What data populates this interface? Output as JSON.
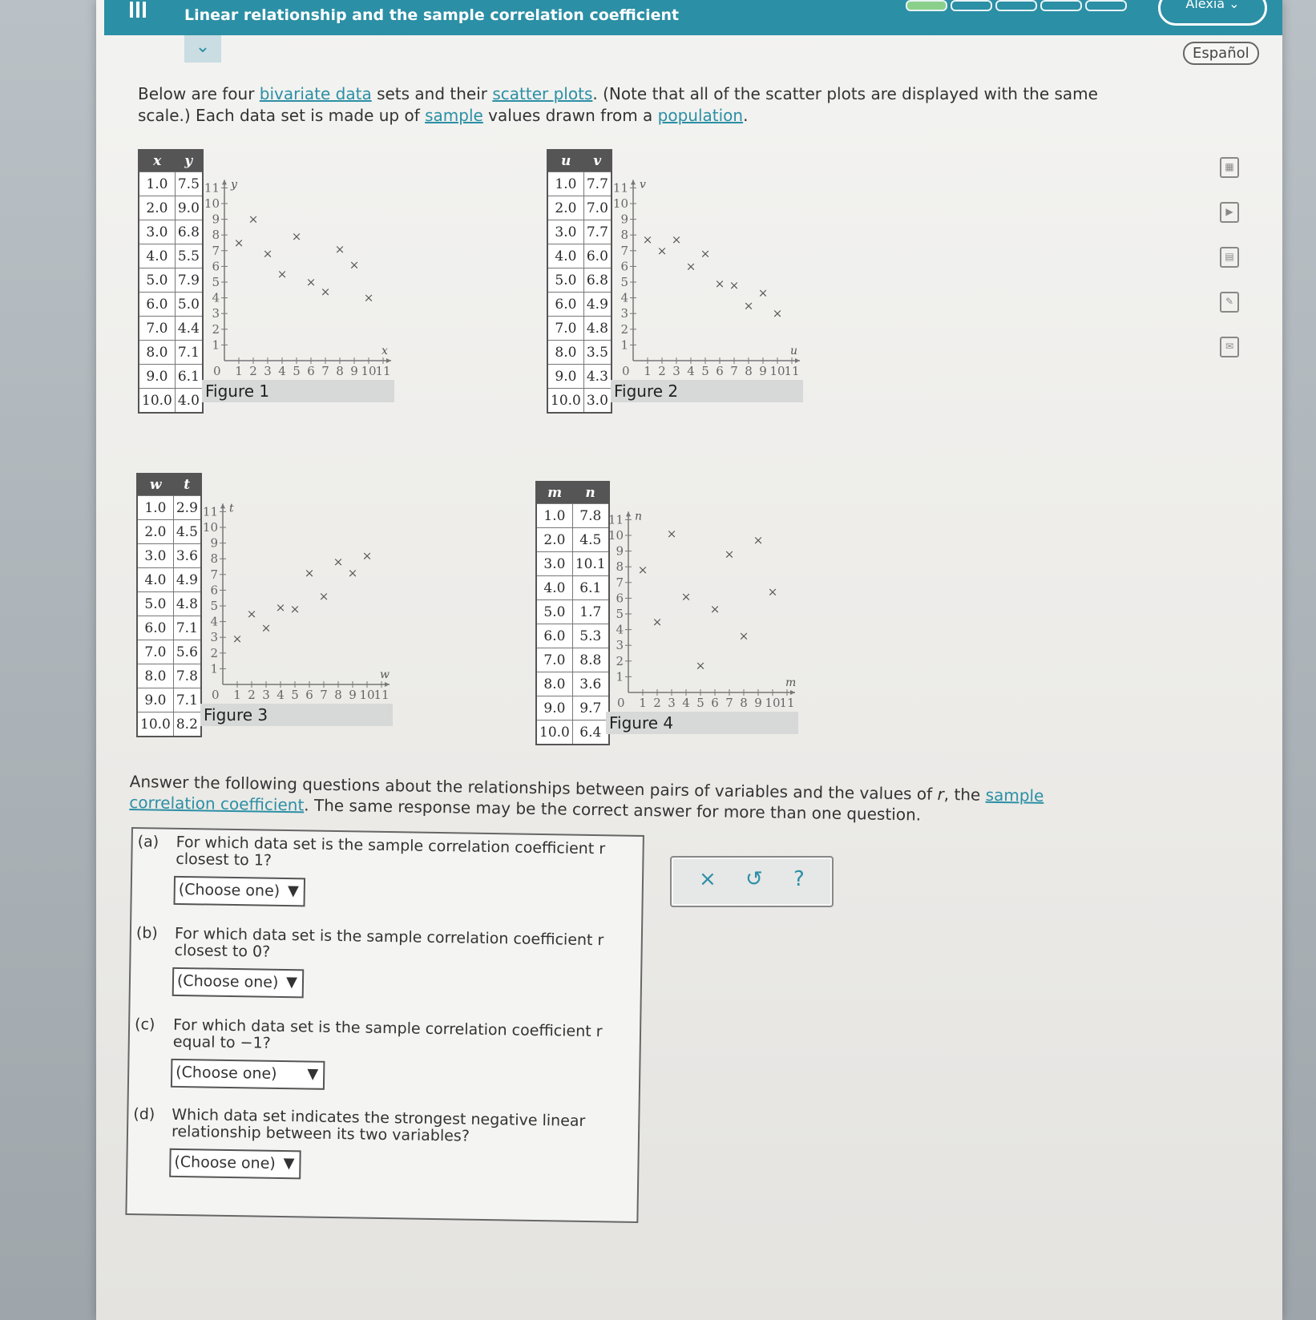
{
  "header": {
    "title": "Linear relationship and the sample correlation coefficient",
    "user": "Alexia",
    "language": "Español",
    "progress_segments_done": 1,
    "progress_segments_total": 5
  },
  "intro": {
    "t1": "Below are four ",
    "link1": "bivariate data",
    "t2": " sets and their ",
    "link2": "scatter plots",
    "t3": ". (Note that all of the scatter plots are displayed with the same scale.) Each data set is made up of ",
    "link3": "sample",
    "t4": " values drawn from a ",
    "link4": "population",
    "t5": "."
  },
  "datasets": [
    {
      "figure": "Figure 1",
      "xvar": "x",
      "yvar": "y",
      "x": [
        1.0,
        2.0,
        3.0,
        4.0,
        5.0,
        6.0,
        7.0,
        8.0,
        9.0,
        10.0
      ],
      "y": [
        7.5,
        9.0,
        6.8,
        5.5,
        7.9,
        5.0,
        4.4,
        7.1,
        6.1,
        4.0
      ]
    },
    {
      "figure": "Figure 2",
      "xvar": "u",
      "yvar": "v",
      "x": [
        1.0,
        2.0,
        3.0,
        4.0,
        5.0,
        6.0,
        7.0,
        8.0,
        9.0,
        10.0
      ],
      "y": [
        7.7,
        7.0,
        7.7,
        6.0,
        6.8,
        4.9,
        4.8,
        3.5,
        4.3,
        3.0
      ]
    },
    {
      "figure": "Figure 3",
      "xvar": "w",
      "yvar": "t",
      "x": [
        1.0,
        2.0,
        3.0,
        4.0,
        5.0,
        6.0,
        7.0,
        8.0,
        9.0,
        10.0
      ],
      "y": [
        2.9,
        4.5,
        3.6,
        4.9,
        4.8,
        7.1,
        5.6,
        7.8,
        7.1,
        8.2
      ]
    },
    {
      "figure": "Figure 4",
      "xvar": "m",
      "yvar": "n",
      "x": [
        1.0,
        2.0,
        3.0,
        4.0,
        5.0,
        6.0,
        7.0,
        8.0,
        9.0,
        10.0
      ],
      "y": [
        7.8,
        4.5,
        10.1,
        6.1,
        1.7,
        5.3,
        8.8,
        3.6,
        9.7,
        6.4
      ]
    }
  ],
  "axis": {
    "min": 0,
    "max": 11,
    "ticks": [
      "1",
      "2",
      "3",
      "4",
      "5",
      "6",
      "7",
      "8",
      "9",
      "10",
      "11"
    ],
    "origin": "0"
  },
  "answer_intro": {
    "t1": "Answer the following questions about the relationships between pairs of variables and the values of ",
    "var": "r",
    "t2": ", the ",
    "link": "sample correlation coefficient",
    "t3": ". The same response may be the correct answer for more than one question."
  },
  "questions": [
    {
      "label": "(a)",
      "text": "For which data set is the sample correlation coefficient r closest to 1?",
      "select": "(Choose one)"
    },
    {
      "label": "(b)",
      "text": "For which data set is the sample correlation coefficient r closest to 0?",
      "select": "(Choose one)"
    },
    {
      "label": "(c)",
      "text": "For which data set is the sample correlation coefficient r equal to −1?",
      "select": "(Choose one)"
    },
    {
      "label": "(d)",
      "text": "Which data set indicates the strongest negative linear relationship between its two variables?",
      "select": "(Choose one)"
    }
  ],
  "tools": {
    "clear": "×",
    "undo": "↺",
    "help": "?"
  },
  "sidebar_icons": [
    "calculator-icon",
    "video-icon",
    "table-icon",
    "notes-icon",
    "mail-icon"
  ]
}
